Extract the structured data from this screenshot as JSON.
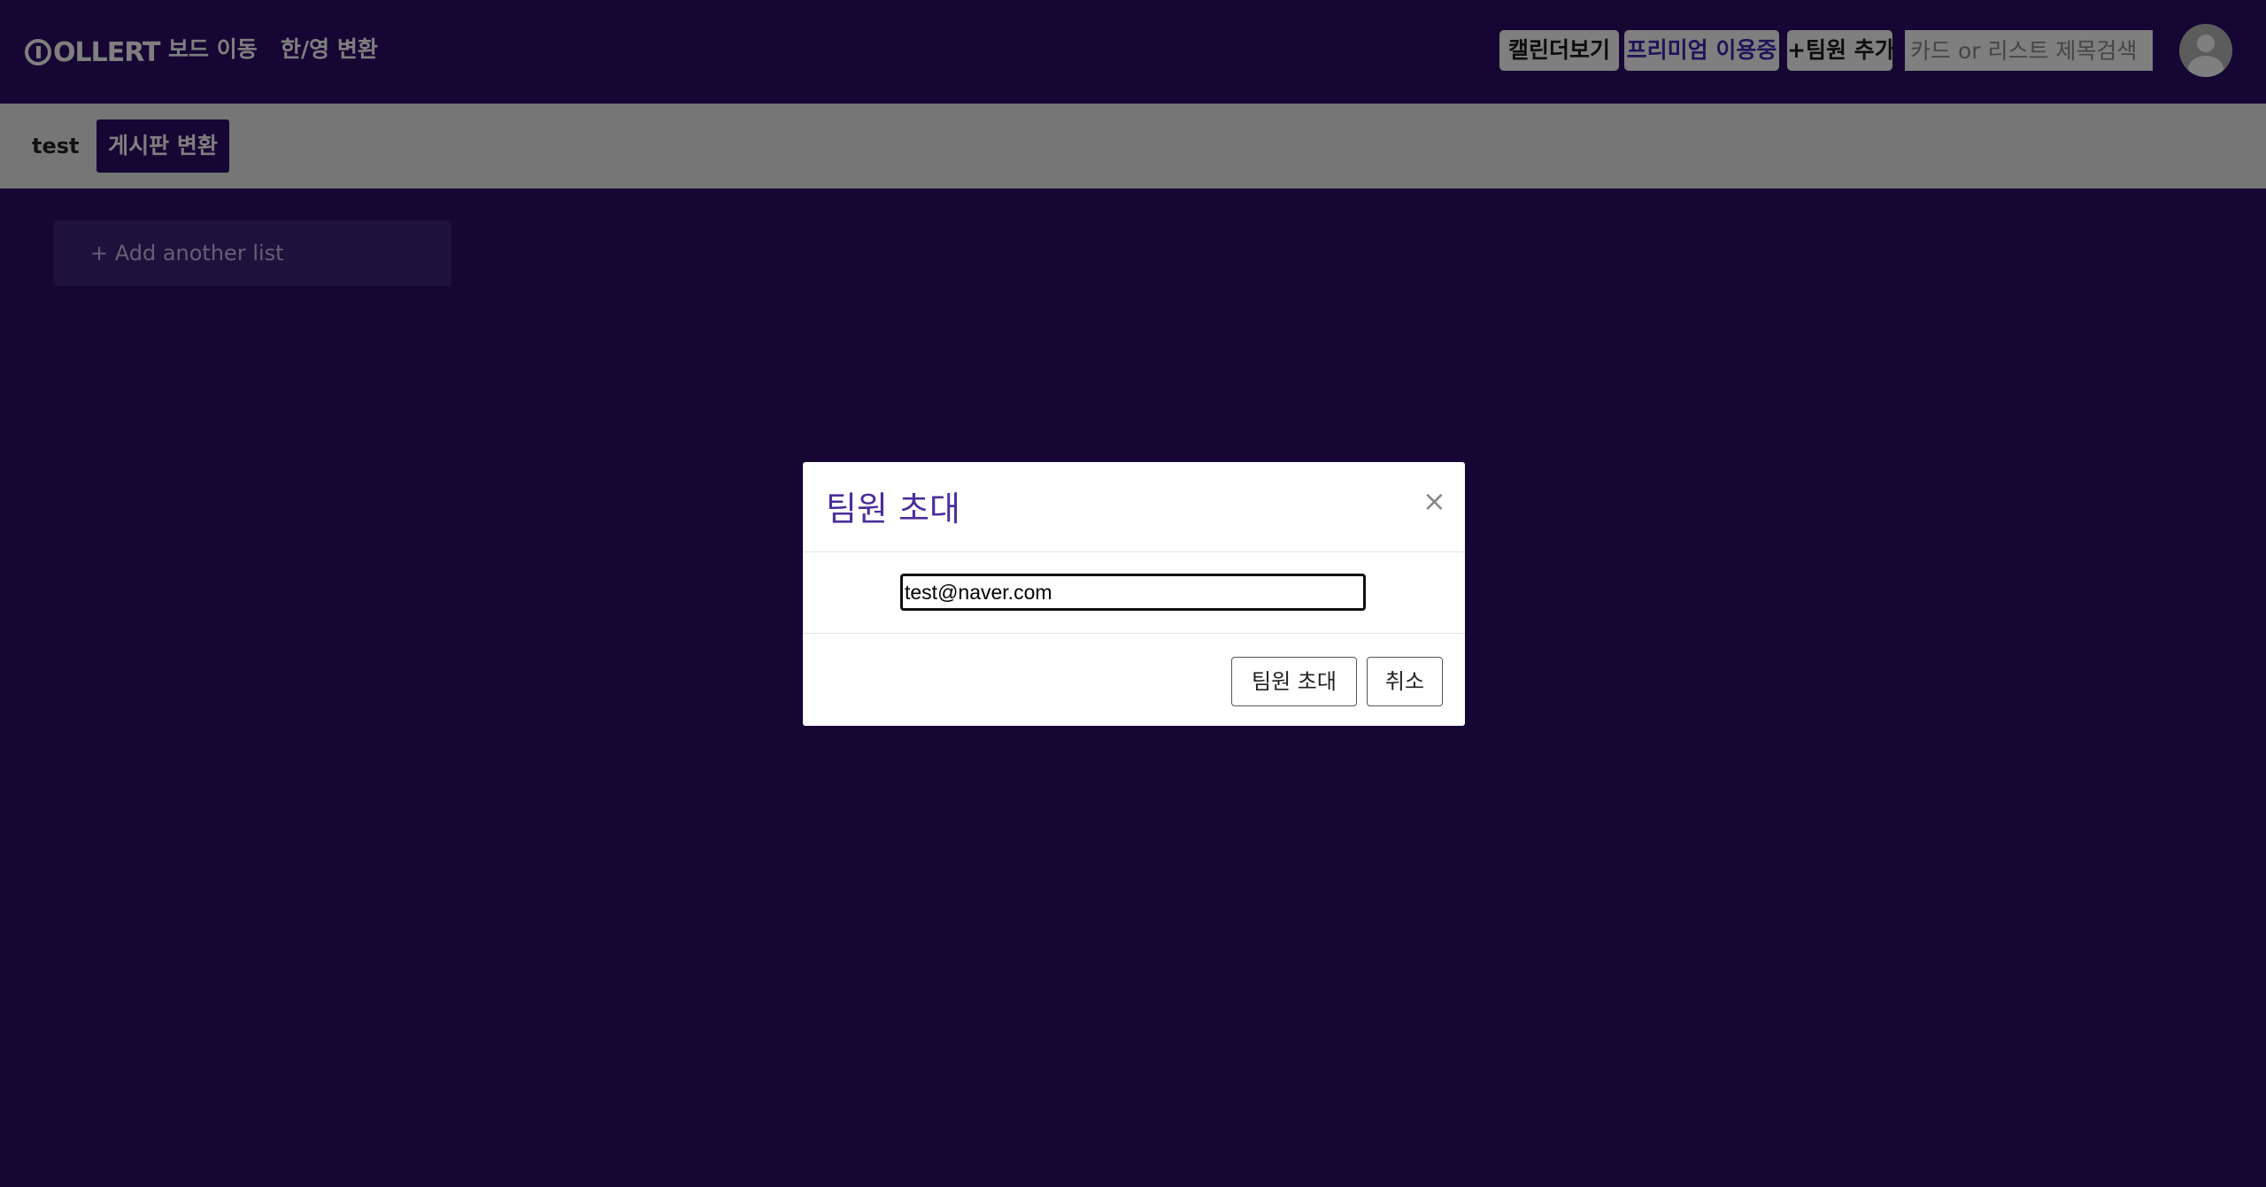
{
  "header": {
    "logo_text": "OLLERT",
    "nav": {
      "board_move": "보드 이동",
      "lang_toggle": "한/영 변환"
    },
    "buttons": {
      "calendar": "캘린더보기",
      "premium": "프리미엄 이용중",
      "add_member": "+팀원 추가"
    },
    "search": {
      "placeholder": "카드 or 리스트 제목검색",
      "value": ""
    }
  },
  "board": {
    "name": "test",
    "switch_label": "게시판 변환",
    "add_list_label": "+ Add another list"
  },
  "modal": {
    "title": "팀원 초대",
    "close_symbol": "×",
    "email_value": "test@naver.com",
    "invite_label": "팀원 초대",
    "cancel_label": "취소"
  },
  "colors": {
    "header_bg": "#2a0d66",
    "accent": "#4b2d9b",
    "overlay": "rgba(0,0,0,0.5)"
  }
}
